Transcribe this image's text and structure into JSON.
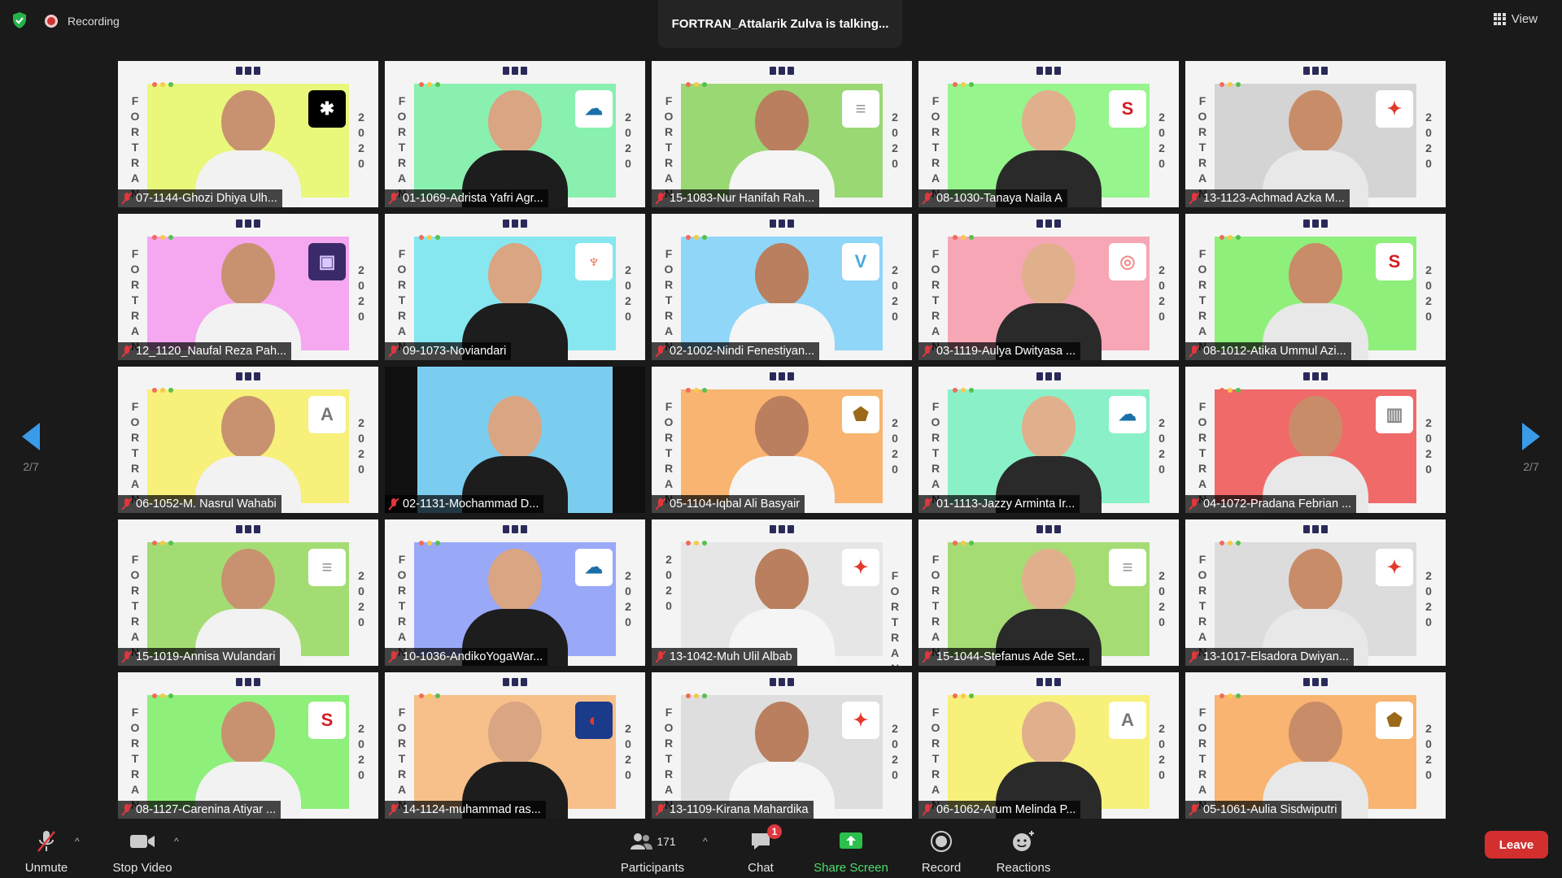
{
  "top": {
    "recording_label": "Recording",
    "talking_text": "FORTRAN_Attalarik Zulva is talking...",
    "view_label": "View"
  },
  "pagination": {
    "left": "2/7",
    "right": "2/7"
  },
  "tile_text": {
    "left": "FORTRAN",
    "right": "2020",
    "left_reversed": "2020",
    "right_reversed": "FORTRAN"
  },
  "participants": [
    {
      "name": "07-1144-Ghozi Dhiya Ulh...",
      "bg": "#e9f77a",
      "logo": "black"
    },
    {
      "name": "01-1069-Adrista Yafri Agr...",
      "bg": "#8af0b0",
      "logo": "cloud"
    },
    {
      "name": "15-1083-Nur Hanifah Rah...",
      "bg": "#9ad873",
      "logo": "text"
    },
    {
      "name": "08-1030-Tanaya Naila A",
      "bg": "#96f58c",
      "logo": "s"
    },
    {
      "name": "13-1123-Achmad Azka M...",
      "bg": "#d4d4d4",
      "logo": "star"
    },
    {
      "name": "12_1120_Naufal Reza Pah...",
      "bg": "#f5a7f0",
      "logo": "purple"
    },
    {
      "name": "09-1073-Noviandari",
      "bg": "#86e7f0",
      "logo": "deer"
    },
    {
      "name": "02-1002-Nindi Fenestiyan...",
      "bg": "#8fd6f8",
      "logo": "v"
    },
    {
      "name": "03-1119-Aulya Dwityasa ...",
      "bg": "#f7a6b6",
      "logo": "ring"
    },
    {
      "name": "08-1012-Atika Ummul Azi...",
      "bg": "#8ef07a",
      "logo": "s"
    },
    {
      "name": "06-1052-M. Nasrul Wahabi",
      "bg": "#f7f07a",
      "logo": "aie"
    },
    {
      "name": "02-1131-Mochammad D...",
      "bg": "#7bcdf0",
      "logo": "none"
    },
    {
      "name": "05-1104-Iqbal Ali Basyair",
      "bg": "#f8b470",
      "logo": "pentagon"
    },
    {
      "name": "01-1113-Jazzy Arminta Ir...",
      "bg": "#8af0c8",
      "logo": "cloud"
    },
    {
      "name": "04-1072-Pradana Febrian ...",
      "bg": "#f06a6a",
      "logo": "building"
    },
    {
      "name": "15-1019-Annisa Wulandari",
      "bg": "#a4dc74",
      "logo": "text"
    },
    {
      "name": "10-1036-AndikoYogaWar...",
      "bg": "#9aa8f8",
      "logo": "cloud"
    },
    {
      "name": "13-1042-Muh Ulil Albab",
      "bg": "#e6e6e6",
      "logo": "star"
    },
    {
      "name": "15-1044-Stefanus Ade Set...",
      "bg": "#a6dc74",
      "logo": "text"
    },
    {
      "name": "13-1017-Elsadora Dwiyan...",
      "bg": "#dcdcdc",
      "logo": "star"
    },
    {
      "name": "08-1127-Carenina Atiyar ...",
      "bg": "#8ef07a",
      "logo": "s"
    },
    {
      "name": "14-1124-muhammad ras...",
      "bg": "#f7c08a",
      "logo": "blue"
    },
    {
      "name": "13-1109-Kirana Mahardika",
      "bg": "#dedede",
      "logo": "star"
    },
    {
      "name": "06-1062-Arum Melinda P...",
      "bg": "#f7f07a",
      "logo": "aie"
    },
    {
      "name": "05-1061-Aulia Sisdwiputri",
      "bg": "#f8b470",
      "logo": "pentagon"
    }
  ],
  "toolbar": {
    "unmute": "Unmute",
    "stop_video": "Stop Video",
    "participants": "Participants",
    "participants_count": "171",
    "chat": "Chat",
    "chat_badge": "1",
    "share_screen": "Share Screen",
    "record": "Record",
    "reactions": "Reactions",
    "leave": "Leave"
  },
  "colors": {
    "accent_blue": "#3a9be8",
    "leave_red": "#d32f2f",
    "share_green": "#4ede6e",
    "mic_muted_red": "#e0363d"
  }
}
